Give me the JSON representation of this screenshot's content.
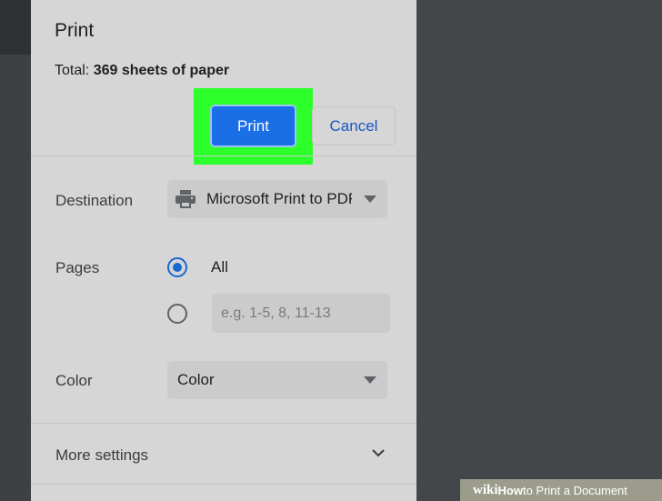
{
  "dialog": {
    "title": "Print",
    "total_label": "Total:",
    "total_value": "369 sheets of paper",
    "print_label": "Print",
    "cancel_label": "Cancel"
  },
  "destination": {
    "label": "Destination",
    "value": "Microsoft Print to PDF",
    "icon": "printer-icon"
  },
  "pages": {
    "label": "Pages",
    "all_label": "All",
    "selected": "All",
    "custom_placeholder": "e.g. 1-5, 8, 11-13"
  },
  "color": {
    "label": "Color",
    "value": "Color"
  },
  "more_settings": {
    "label": "More settings",
    "icon": "chevron-down-icon"
  },
  "watermark": {
    "brand": "wiki",
    "how": "How",
    "rest": " to Print a Document"
  },
  "colors": {
    "accent": "#1a6fe6",
    "highlight": "#2cff2a",
    "panel": "#d6d6d6",
    "background": "#434749"
  }
}
